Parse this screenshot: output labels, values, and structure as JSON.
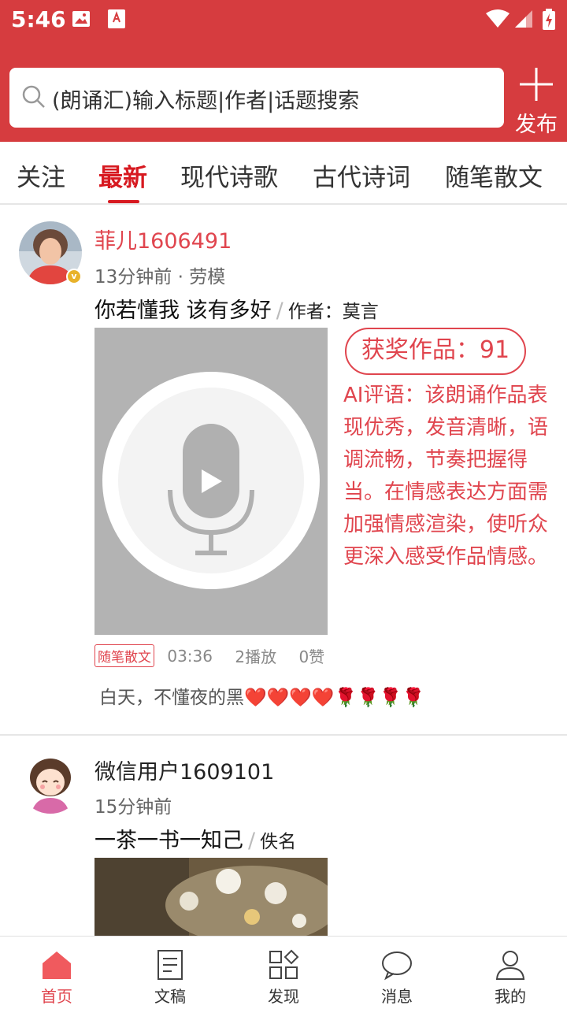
{
  "status_bar": {
    "time": "5:46"
  },
  "search": {
    "placeholder": "(朗诵汇)输入标题|作者|话题搜索"
  },
  "publish": {
    "label": "发布"
  },
  "tabs": [
    {
      "label": "关注",
      "active": false
    },
    {
      "label": "最新",
      "active": true
    },
    {
      "label": "现代诗歌",
      "active": false
    },
    {
      "label": "古代诗词",
      "active": false
    },
    {
      "label": "随笔散文",
      "active": false
    }
  ],
  "posts": [
    {
      "username": "菲儿1606491",
      "verified_badge": "v",
      "time_ago": "13分钟前 · 劳模",
      "title": "你若懂我   该有多好",
      "author": "作者：莫言",
      "award": "获奖作品：91",
      "ai_review": "AI评语：该朗诵作品表现优秀，发音清晰，语调流畅，节奏把握得当。在情感表达方面需加强情感渲染，使听众更深入感受作品情感。",
      "category": "随笔散文",
      "duration": "03:36",
      "plays": "2播放",
      "likes": "0赞",
      "comment": "白天，不懂夜的黑❤️❤️❤️❤️🌹🌹🌹🌹"
    },
    {
      "username": "微信用户1609101",
      "time_ago": "15分钟前",
      "title": "一茶一书一知己",
      "author": "佚名"
    }
  ],
  "bottom_nav": [
    {
      "label": "首页",
      "icon": "home-icon",
      "active": true
    },
    {
      "label": "文稿",
      "icon": "document-icon",
      "active": false
    },
    {
      "label": "发现",
      "icon": "discover-grid-icon",
      "active": false
    },
    {
      "label": "消息",
      "icon": "message-bubble-icon",
      "active": false
    },
    {
      "label": "我的",
      "icon": "user-icon",
      "active": false
    }
  ],
  "colors": {
    "brand_red": "#d63c3f",
    "active_tab": "#d71920",
    "accent_text": "#e0454e"
  }
}
